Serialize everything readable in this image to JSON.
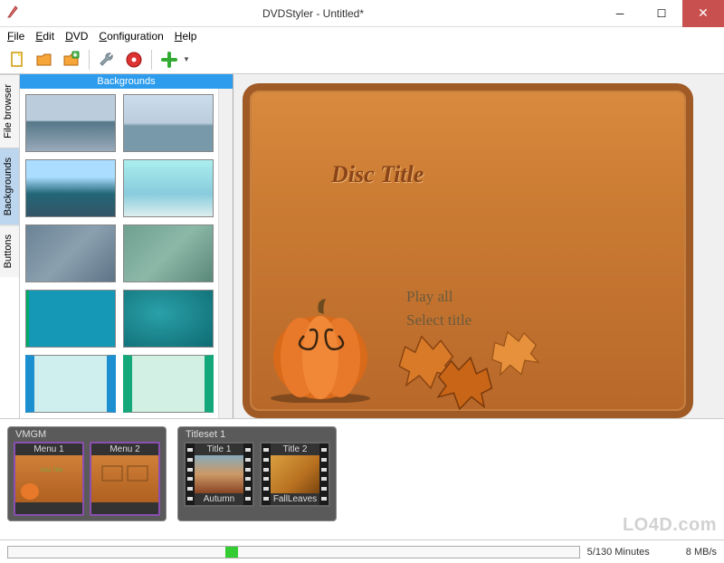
{
  "window": {
    "title": "DVDStyler - Untitled*",
    "min": "─",
    "max": "☐",
    "close": "✕"
  },
  "menu": {
    "file": "File",
    "edit": "Edit",
    "dvd": "DVD",
    "config": "Configuration",
    "help": "Help"
  },
  "toolbar_icons": {
    "new": "new-file-icon",
    "open": "open-folder-icon",
    "save": "save-icon",
    "settings": "wrench-icon",
    "burn": "burn-disc-icon",
    "add": "add-plus-icon"
  },
  "side_tabs": {
    "file_browser": "File browser",
    "backgrounds": "Backgrounds",
    "buttons": "Buttons"
  },
  "browser": {
    "heading": "Backgrounds"
  },
  "backgrounds": [
    {
      "grad": "island"
    },
    {
      "grad": "ship"
    },
    {
      "grad": "coast"
    },
    {
      "grad": "bluefade"
    },
    {
      "grad": "bluegray"
    },
    {
      "grad": "tealcloud"
    },
    {
      "grad": "stripes"
    },
    {
      "grad": "tealwave"
    },
    {
      "grad": "bluebars"
    },
    {
      "grad": "mintbox"
    }
  ],
  "preview": {
    "disc_title": "Disc Title",
    "play_all": "Play all",
    "select_title": "Select title"
  },
  "timeline": {
    "vmgm": {
      "label": "VMGM",
      "items": [
        {
          "label": "Menu 1",
          "foot": ""
        },
        {
          "label": "Menu 2",
          "foot": ""
        }
      ]
    },
    "titleset1": {
      "label": "Titleset 1",
      "items": [
        {
          "label": "Title 1",
          "foot": "Autumn"
        },
        {
          "label": "Title 2",
          "foot": "FallLeaves"
        }
      ]
    }
  },
  "status": {
    "minutes": "5/130 Minutes",
    "rate": "8 MB/s"
  },
  "watermark": "LO4D.com"
}
